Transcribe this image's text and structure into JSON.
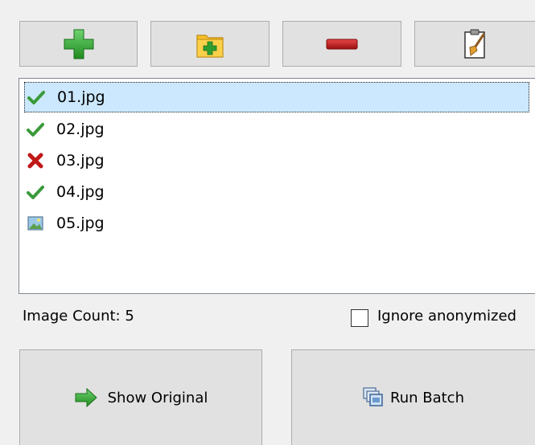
{
  "toolbar": {
    "add_icon": "plus-icon",
    "add_folder_icon": "folder-add-icon",
    "remove_icon": "minus-icon",
    "clear_icon": "clipboard-broom-icon"
  },
  "file_list": {
    "items": [
      {
        "name": "01.jpg",
        "status": "ok",
        "selected": true
      },
      {
        "name": "02.jpg",
        "status": "ok",
        "selected": false
      },
      {
        "name": "03.jpg",
        "status": "error",
        "selected": false
      },
      {
        "name": "04.jpg",
        "status": "ok",
        "selected": false
      },
      {
        "name": "05.jpg",
        "status": "pending",
        "selected": false
      }
    ]
  },
  "status": {
    "image_count": "Image Count: 5"
  },
  "options": {
    "ignore_anonymized_label": "Ignore anonymized",
    "ignore_anonymized_checked": false
  },
  "actions": {
    "show_original_label": "Show Original",
    "run_batch_label": "Run Batch"
  },
  "colors": {
    "ok": "#3a9a3a",
    "error": "#c01818",
    "selection": "#cce8ff",
    "button_face": "#e1e1e1"
  }
}
